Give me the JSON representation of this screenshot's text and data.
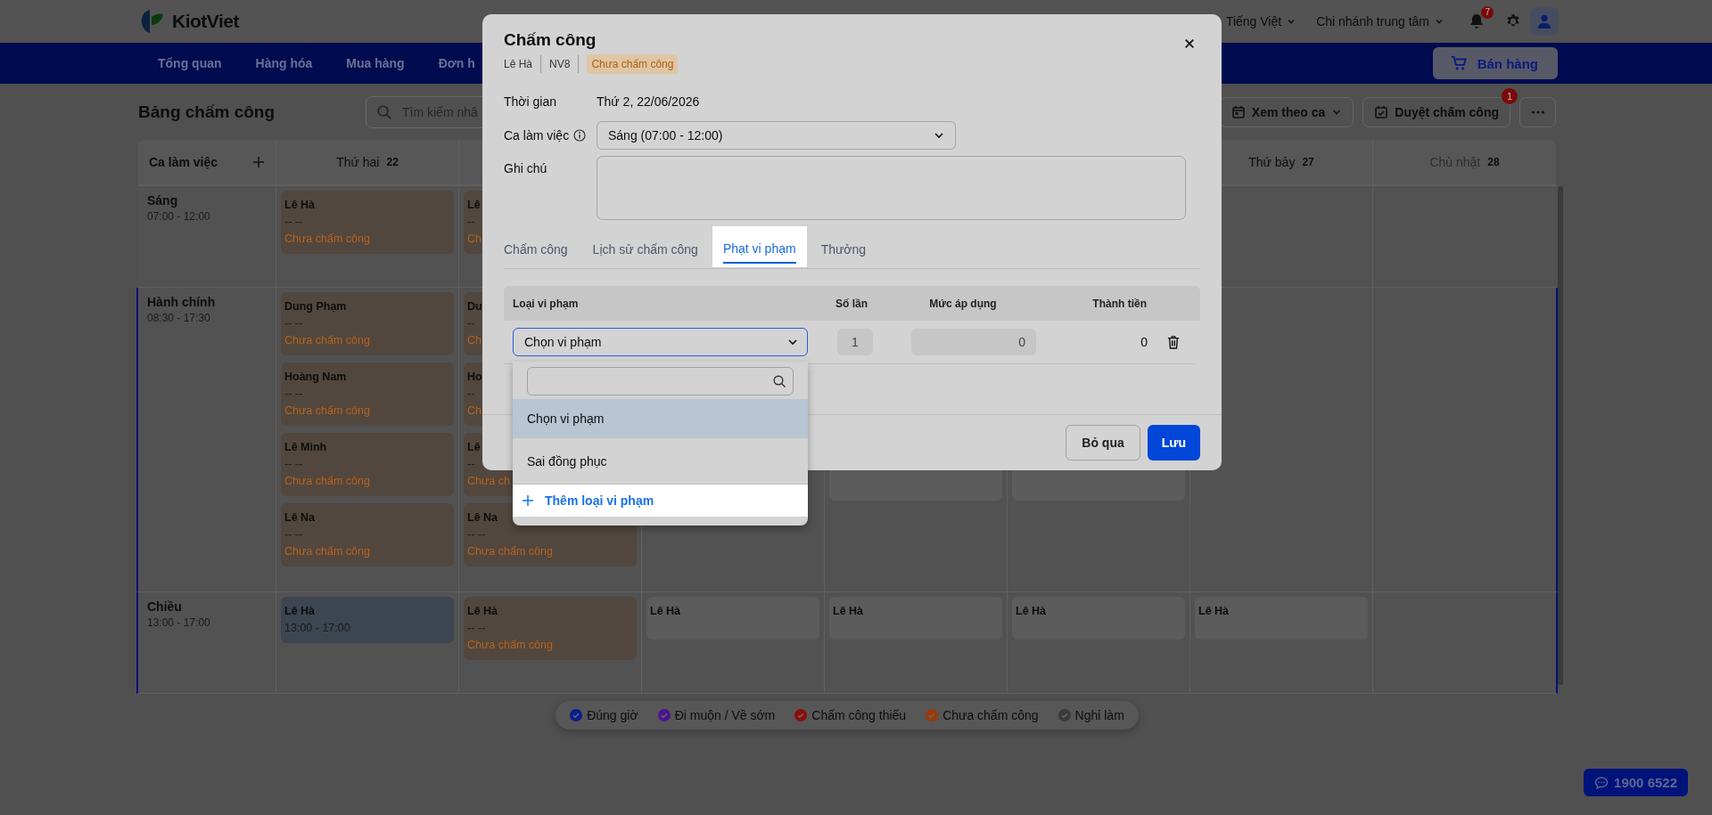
{
  "header": {
    "logo": "KiotViet",
    "language": "Tiếng Việt",
    "branch": "Chi nhánh trung tâm",
    "notification_count": "7"
  },
  "nav": {
    "items": [
      "Tổng quan",
      "Hàng hóa",
      "Mua hàng",
      "Đơn h"
    ],
    "sell_button": "Bán hàng"
  },
  "toolbar": {
    "title": "Bảng chấm công",
    "search": {
      "placeholder": "Tìm kiếm nhâ"
    },
    "view_button": "Xem theo ca",
    "approve_button": "Duyệt chấm công",
    "approve_badge": "1"
  },
  "table": {
    "corner_label": "Ca làm việc",
    "columns": [
      {
        "day": "Thứ hai",
        "date": "22",
        "weekend": false
      },
      {},
      {},
      {},
      {},
      {
        "day": "Thứ bảy",
        "date": "27",
        "weekend": false
      },
      {
        "day": "Chủ nhật",
        "date": "28",
        "weekend": true
      }
    ],
    "shifts": [
      {
        "name": "Sáng",
        "hours": "07:00 - 12:00",
        "highlighted": false,
        "cells": [
          [
            {
              "kind": "pending",
              "name": "Lê Hà",
              "time": "-- --",
              "status": "Chưa chấm công"
            }
          ],
          [
            {
              "kind": "pending",
              "name": "Lê",
              "time": "--",
              "status": "Ch"
            }
          ],
          [],
          [],
          [],
          [],
          []
        ]
      },
      {
        "name": "Hành chính",
        "hours": "08:30 - 17:30",
        "highlighted": true,
        "cells": [
          [
            {
              "kind": "pending",
              "name": "Dung Phạm",
              "time": "-- --",
              "status": "Chưa chấm công"
            },
            {
              "kind": "pending",
              "name": "Hoàng Nam",
              "time": "-- --",
              "status": "Chưa chấm công"
            },
            {
              "kind": "pending",
              "name": "Lê Minh",
              "time": "-- --",
              "status": "Chưa chấm công"
            },
            {
              "kind": "pending",
              "name": "Lê Na",
              "time": "-- --",
              "status": "Chưa chấm công"
            }
          ],
          [
            {
              "kind": "pending",
              "name": "Du",
              "time": "--",
              "status": "Ch"
            },
            {
              "kind": "pending",
              "name": "Ho",
              "time": "--",
              "status": "Ch"
            },
            {
              "kind": "pending",
              "name": "Lê",
              "time": "--",
              "status": "Chưa ch"
            },
            {
              "kind": "pending",
              "name": "Lê Na",
              "time": "-- --",
              "status": "Chưa chấm công"
            }
          ],
          [],
          [
            {
              "kind": "covered"
            },
            {
              "kind": "covered"
            },
            {
              "kind": "covered"
            },
            {
              "kind": "off"
            }
          ],
          [
            {
              "kind": "covered"
            },
            {
              "kind": "covered"
            },
            {
              "kind": "covered"
            },
            {
              "kind": "off"
            }
          ],
          [],
          []
        ]
      },
      {
        "name": "Chiều",
        "hours": "13:00 - 17:00",
        "highlighted": true,
        "cells": [
          [
            {
              "kind": "scheduled",
              "name": "Lê Hà",
              "time": "13:00 - 17:00"
            }
          ],
          [
            {
              "kind": "pending",
              "name": "Lê Hà",
              "time": "-- --",
              "status": "Chưa chấm công"
            }
          ],
          [
            {
              "kind": "off",
              "name": "Lê Hà"
            }
          ],
          [
            {
              "kind": "off",
              "name": "Lê Hà"
            }
          ],
          [
            {
              "kind": "off",
              "name": "Lê Hà"
            }
          ],
          [
            {
              "kind": "off",
              "name": "Lê Hà"
            }
          ],
          []
        ]
      }
    ]
  },
  "legend": [
    {
      "label": "Đúng giờ",
      "color": "#0a1e8c"
    },
    {
      "label": "Đi muộn / Về sớm",
      "color": "#4a1490"
    },
    {
      "label": "Chấm công thiếu",
      "color": "#8a0c0c"
    },
    {
      "label": "Chưa chấm công",
      "color": "#9a3a08"
    },
    {
      "label": "Nghỉ làm",
      "color": "#3a3a3a"
    }
  ],
  "hotline": "1900 6522",
  "dialog": {
    "title": "Chấm công",
    "employee": "Lê Hà",
    "code": "NV8",
    "status": "Chưa chấm công",
    "fields": [
      {
        "label": "Thời gian",
        "kind": "text",
        "value": "Thứ 2, 22/06/2026"
      },
      {
        "label": "Ca làm việc",
        "kind": "select",
        "info": true,
        "value": "Sáng (07:00 - 12:00)"
      },
      {
        "label": "Ghi chú",
        "kind": "textarea"
      }
    ],
    "tabs": [
      {
        "label": "Chấm công",
        "selected": false
      },
      {
        "label": "Lịch sử chấm công",
        "selected": false
      },
      {
        "label": "Phạt vi phạm",
        "selected": true
      },
      {
        "label": "Thưởng",
        "selected": false
      }
    ],
    "penalty_table": {
      "columns": [
        "Loại vi phạm",
        "Số lần",
        "Mức áp dụng",
        "Thành tiền"
      ],
      "rows": [
        {
          "type": "Chọn vi phạm",
          "count": "1",
          "rate": "0",
          "amount": "0",
          "expanded": true
        }
      ]
    },
    "dropdown": {
      "options": [
        {
          "label": "Chọn vi phạm",
          "selected": true
        },
        {
          "label": "Sai đồng phục",
          "selected": false
        }
      ],
      "add_label": "Thêm loại vi phạm"
    },
    "buttons": [
      {
        "label": "Bỏ qua",
        "kind": "secondary"
      },
      {
        "label": "Lưu",
        "kind": "primary"
      }
    ]
  }
}
